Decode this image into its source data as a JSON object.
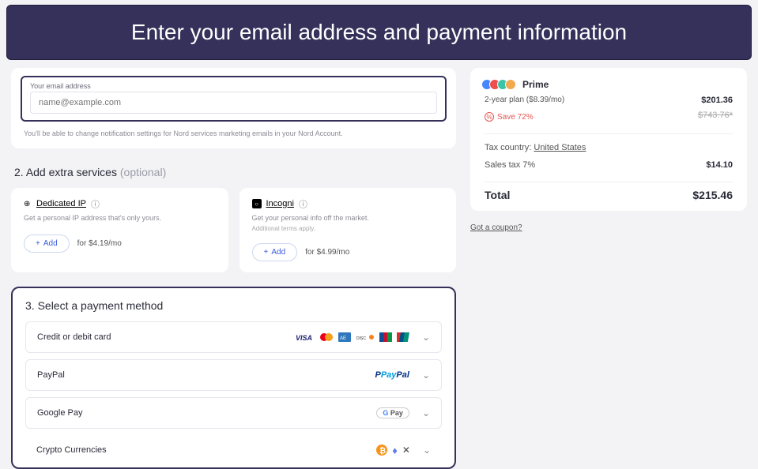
{
  "banner": "Enter your email address and payment information",
  "email": {
    "label": "Your email address",
    "placeholder": "name@example.com",
    "note": "You'll be able to change notification settings for Nord services marketing emails in your Nord Account."
  },
  "extras": {
    "title_number": "2.",
    "title": "Add extra services",
    "optional": "(optional)",
    "dedicated": {
      "name": "Dedicated IP",
      "desc": "Get a personal IP address that's only yours.",
      "add": "Add",
      "price_prefix": "for",
      "price": "$4.19/mo"
    },
    "incogni": {
      "name": "Incogni",
      "desc": "Get your personal info off the market.",
      "sub": "Additional terms apply.",
      "add": "Add",
      "price_prefix": "for",
      "price": "$4.99/mo"
    }
  },
  "payment": {
    "title": "3. Select a payment method",
    "credit": "Credit or debit card",
    "paypal": "PayPal",
    "gpay": "Google Pay",
    "crypto": "Crypto Currencies"
  },
  "summary": {
    "plan_name": "Prime",
    "plan_line": "2-year plan ($8.39/mo)",
    "plan_price": "$201.36",
    "old_price": "$743.76*",
    "save": "Save 72%",
    "tax_country_label": "Tax country:",
    "tax_country": "United States",
    "tax_label": "Sales tax 7%",
    "tax_amount": "$14.10",
    "total_label": "Total",
    "total": "$215.46",
    "coupon": "Got a coupon?"
  }
}
